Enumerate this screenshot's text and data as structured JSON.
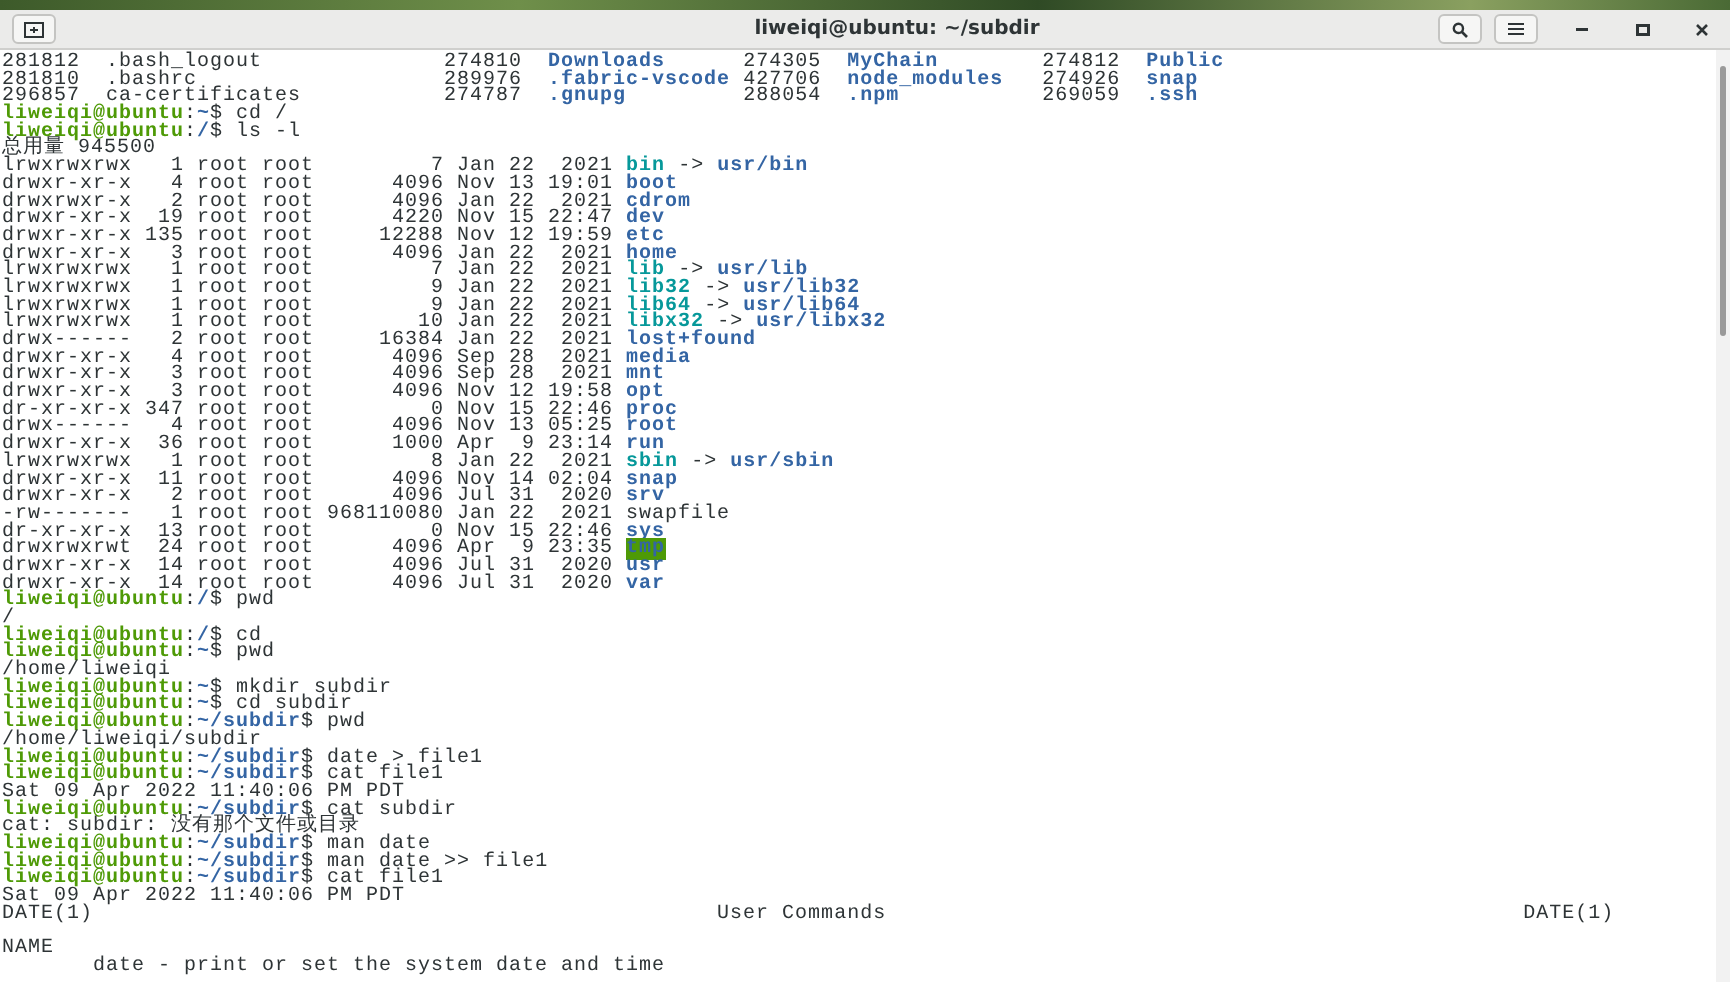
{
  "window": {
    "title": "liweiqi@ubuntu: ~/subdir"
  },
  "terminal": {
    "lines": [
      {
        "kind": "text",
        "segments": [
          {
            "text": "281812  .bash_logout              274810  ",
            "kind": "plain"
          },
          {
            "text": "Downloads",
            "kind": "dir"
          },
          {
            "text": "      274305  ",
            "kind": "plain"
          },
          {
            "text": "MyChain",
            "kind": "dir"
          },
          {
            "text": "        274812  ",
            "kind": "plain"
          },
          {
            "text": "Public",
            "kind": "dir"
          }
        ]
      },
      {
        "kind": "text",
        "segments": [
          {
            "text": "281810  .bashrc                   289976  ",
            "kind": "plain"
          },
          {
            "text": ".fabric-vscode",
            "kind": "dir"
          },
          {
            "text": " 427706  ",
            "kind": "plain"
          },
          {
            "text": "node_modules",
            "kind": "dir"
          },
          {
            "text": "   274926  ",
            "kind": "plain"
          },
          {
            "text": "snap",
            "kind": "dir"
          }
        ]
      },
      {
        "kind": "text",
        "segments": [
          {
            "text": "296857  ca-certificates           274787  ",
            "kind": "plain"
          },
          {
            "text": ".gnupg",
            "kind": "dir"
          },
          {
            "text": "         288054  ",
            "kind": "plain"
          },
          {
            "text": ".npm",
            "kind": "dir"
          },
          {
            "text": "           269059  ",
            "kind": "plain"
          },
          {
            "text": ".ssh",
            "kind": "dir"
          }
        ]
      },
      {
        "kind": "text",
        "segments": [
          {
            "text": "liweiqi@ubuntu",
            "kind": "user"
          },
          {
            "text": ":",
            "kind": "plain"
          },
          {
            "text": "~",
            "kind": "path"
          },
          {
            "text": "$ cd /",
            "kind": "plain"
          }
        ]
      },
      {
        "kind": "text",
        "segments": [
          {
            "text": "liweiqi@ubuntu",
            "kind": "user"
          },
          {
            "text": ":",
            "kind": "plain"
          },
          {
            "text": "/",
            "kind": "path"
          },
          {
            "text": "$ ls -l",
            "kind": "plain"
          }
        ]
      },
      {
        "kind": "text",
        "segments": [
          {
            "text": "总用量 945500",
            "kind": "plain"
          }
        ]
      },
      {
        "kind": "text",
        "segments": [
          {
            "text": "lrwxrwxrwx   1 root root         7 Jan 22  2021 ",
            "kind": "plain"
          },
          {
            "text": "bin",
            "kind": "link"
          },
          {
            "text": " -> ",
            "kind": "plain"
          },
          {
            "text": "usr/bin",
            "kind": "dir"
          }
        ]
      },
      {
        "kind": "text",
        "segments": [
          {
            "text": "drwxr-xr-x   4 root root      4096 Nov 13 19:01 ",
            "kind": "plain"
          },
          {
            "text": "boot",
            "kind": "dir"
          }
        ]
      },
      {
        "kind": "text",
        "segments": [
          {
            "text": "drwxrwxr-x   2 root root      4096 Jan 22  2021 ",
            "kind": "plain"
          },
          {
            "text": "cdrom",
            "kind": "dir"
          }
        ]
      },
      {
        "kind": "text",
        "segments": [
          {
            "text": "drwxr-xr-x  19 root root      4220 Nov 15 22:47 ",
            "kind": "plain"
          },
          {
            "text": "dev",
            "kind": "dir"
          }
        ]
      },
      {
        "kind": "text",
        "segments": [
          {
            "text": "drwxr-xr-x 135 root root     12288 Nov 12 19:59 ",
            "kind": "plain"
          },
          {
            "text": "etc",
            "kind": "dir"
          }
        ]
      },
      {
        "kind": "text",
        "segments": [
          {
            "text": "drwxr-xr-x   3 root root      4096 Jan 22  2021 ",
            "kind": "plain"
          },
          {
            "text": "home",
            "kind": "dir"
          }
        ]
      },
      {
        "kind": "text",
        "segments": [
          {
            "text": "lrwxrwxrwx   1 root root         7 Jan 22  2021 ",
            "kind": "plain"
          },
          {
            "text": "lib",
            "kind": "link"
          },
          {
            "text": " -> ",
            "kind": "plain"
          },
          {
            "text": "usr/lib",
            "kind": "dir"
          }
        ]
      },
      {
        "kind": "text",
        "segments": [
          {
            "text": "lrwxrwxrwx   1 root root         9 Jan 22  2021 ",
            "kind": "plain"
          },
          {
            "text": "lib32",
            "kind": "link"
          },
          {
            "text": " -> ",
            "kind": "plain"
          },
          {
            "text": "usr/lib32",
            "kind": "dir"
          }
        ]
      },
      {
        "kind": "text",
        "segments": [
          {
            "text": "lrwxrwxrwx   1 root root         9 Jan 22  2021 ",
            "kind": "plain"
          },
          {
            "text": "lib64",
            "kind": "link"
          },
          {
            "text": " -> ",
            "kind": "plain"
          },
          {
            "text": "usr/lib64",
            "kind": "dir"
          }
        ]
      },
      {
        "kind": "text",
        "segments": [
          {
            "text": "lrwxrwxrwx   1 root root        10 Jan 22  2021 ",
            "kind": "plain"
          },
          {
            "text": "libx32",
            "kind": "link"
          },
          {
            "text": " -> ",
            "kind": "plain"
          },
          {
            "text": "usr/libx32",
            "kind": "dir"
          }
        ]
      },
      {
        "kind": "text",
        "segments": [
          {
            "text": "drwx------   2 root root     16384 Jan 22  2021 ",
            "kind": "plain"
          },
          {
            "text": "lost+found",
            "kind": "dir"
          }
        ]
      },
      {
        "kind": "text",
        "segments": [
          {
            "text": "drwxr-xr-x   4 root root      4096 Sep 28  2021 ",
            "kind": "plain"
          },
          {
            "text": "media",
            "kind": "dir"
          }
        ]
      },
      {
        "kind": "text",
        "segments": [
          {
            "text": "drwxr-xr-x   3 root root      4096 Sep 28  2021 ",
            "kind": "plain"
          },
          {
            "text": "mnt",
            "kind": "dir"
          }
        ]
      },
      {
        "kind": "text",
        "segments": [
          {
            "text": "drwxr-xr-x   3 root root      4096 Nov 12 19:58 ",
            "kind": "plain"
          },
          {
            "text": "opt",
            "kind": "dir"
          }
        ]
      },
      {
        "kind": "text",
        "segments": [
          {
            "text": "dr-xr-xr-x 347 root root         0 Nov 15 22:46 ",
            "kind": "plain"
          },
          {
            "text": "proc",
            "kind": "dir"
          }
        ]
      },
      {
        "kind": "text",
        "segments": [
          {
            "text": "drwx------   4 root root      4096 Nov 13 05:25 ",
            "kind": "plain"
          },
          {
            "text": "root",
            "kind": "dir"
          }
        ]
      },
      {
        "kind": "text",
        "segments": [
          {
            "text": "drwxr-xr-x  36 root root      1000 Apr  9 23:14 ",
            "kind": "plain"
          },
          {
            "text": "run",
            "kind": "dir"
          }
        ]
      },
      {
        "kind": "text",
        "segments": [
          {
            "text": "lrwxrwxrwx   1 root root         8 Jan 22  2021 ",
            "kind": "plain"
          },
          {
            "text": "sbin",
            "kind": "link"
          },
          {
            "text": " -> ",
            "kind": "plain"
          },
          {
            "text": "usr/sbin",
            "kind": "dir"
          }
        ]
      },
      {
        "kind": "text",
        "segments": [
          {
            "text": "drwxr-xr-x  11 root root      4096 Nov 14 02:04 ",
            "kind": "plain"
          },
          {
            "text": "snap",
            "kind": "dir"
          }
        ]
      },
      {
        "kind": "text",
        "segments": [
          {
            "text": "drwxr-xr-x   2 root root      4096 Jul 31  2020 ",
            "kind": "plain"
          },
          {
            "text": "srv",
            "kind": "dir"
          }
        ]
      },
      {
        "kind": "text",
        "segments": [
          {
            "text": "-rw-------   1 root root 968110080 Jan 22  2021 swapfile",
            "kind": "plain"
          }
        ]
      },
      {
        "kind": "text",
        "segments": [
          {
            "text": "dr-xr-xr-x  13 root root         0 Nov 15 22:46 ",
            "kind": "plain"
          },
          {
            "text": "sys",
            "kind": "dir"
          }
        ]
      },
      {
        "kind": "text",
        "segments": [
          {
            "text": "drwxrwxrwt  24 root root      4096 Apr  9 23:35 ",
            "kind": "plain"
          },
          {
            "text": "tmp",
            "kind": "sticky"
          }
        ]
      },
      {
        "kind": "text",
        "segments": [
          {
            "text": "drwxr-xr-x  14 root root      4096 Jul 31  2020 ",
            "kind": "plain"
          },
          {
            "text": "usr",
            "kind": "dir"
          }
        ]
      },
      {
        "kind": "text",
        "segments": [
          {
            "text": "drwxr-xr-x  14 root root      4096 Jul 31  2020 ",
            "kind": "plain"
          },
          {
            "text": "var",
            "kind": "dir"
          }
        ]
      },
      {
        "kind": "text",
        "segments": [
          {
            "text": "liweiqi@ubuntu",
            "kind": "user"
          },
          {
            "text": ":",
            "kind": "plain"
          },
          {
            "text": "/",
            "kind": "path"
          },
          {
            "text": "$ pwd",
            "kind": "plain"
          }
        ]
      },
      {
        "kind": "text",
        "segments": [
          {
            "text": "/",
            "kind": "plain"
          }
        ]
      },
      {
        "kind": "text",
        "segments": [
          {
            "text": "liweiqi@ubuntu",
            "kind": "user"
          },
          {
            "text": ":",
            "kind": "plain"
          },
          {
            "text": "/",
            "kind": "path"
          },
          {
            "text": "$ cd",
            "kind": "plain"
          }
        ]
      },
      {
        "kind": "text",
        "segments": [
          {
            "text": "liweiqi@ubuntu",
            "kind": "user"
          },
          {
            "text": ":",
            "kind": "plain"
          },
          {
            "text": "~",
            "kind": "path"
          },
          {
            "text": "$ pwd",
            "kind": "plain"
          }
        ]
      },
      {
        "kind": "text",
        "segments": [
          {
            "text": "/home/liweiqi",
            "kind": "plain"
          }
        ]
      },
      {
        "kind": "text",
        "segments": [
          {
            "text": "liweiqi@ubuntu",
            "kind": "user"
          },
          {
            "text": ":",
            "kind": "plain"
          },
          {
            "text": "~",
            "kind": "path"
          },
          {
            "text": "$ mkdir subdir",
            "kind": "plain"
          }
        ]
      },
      {
        "kind": "text",
        "segments": [
          {
            "text": "liweiqi@ubuntu",
            "kind": "user"
          },
          {
            "text": ":",
            "kind": "plain"
          },
          {
            "text": "~",
            "kind": "path"
          },
          {
            "text": "$ cd subdir",
            "kind": "plain"
          }
        ]
      },
      {
        "kind": "text",
        "segments": [
          {
            "text": "liweiqi@ubuntu",
            "kind": "user"
          },
          {
            "text": ":",
            "kind": "plain"
          },
          {
            "text": "~/subdir",
            "kind": "path"
          },
          {
            "text": "$ pwd",
            "kind": "plain"
          }
        ]
      },
      {
        "kind": "text",
        "segments": [
          {
            "text": "/home/liweiqi/subdir",
            "kind": "plain"
          }
        ]
      },
      {
        "kind": "text",
        "segments": [
          {
            "text": "liweiqi@ubuntu",
            "kind": "user"
          },
          {
            "text": ":",
            "kind": "plain"
          },
          {
            "text": "~/subdir",
            "kind": "path"
          },
          {
            "text": "$ date > file1",
            "kind": "plain"
          }
        ]
      },
      {
        "kind": "text",
        "segments": [
          {
            "text": "liweiqi@ubuntu",
            "kind": "user"
          },
          {
            "text": ":",
            "kind": "plain"
          },
          {
            "text": "~/subdir",
            "kind": "path"
          },
          {
            "text": "$ cat file1",
            "kind": "plain"
          }
        ]
      },
      {
        "kind": "text",
        "segments": [
          {
            "text": "Sat 09 Apr 2022 11:40:06 PM PDT",
            "kind": "plain"
          }
        ]
      },
      {
        "kind": "text",
        "segments": [
          {
            "text": "liweiqi@ubuntu",
            "kind": "user"
          },
          {
            "text": ":",
            "kind": "plain"
          },
          {
            "text": "~/subdir",
            "kind": "path"
          },
          {
            "text": "$ cat subdir",
            "kind": "plain"
          }
        ]
      },
      {
        "kind": "text",
        "segments": [
          {
            "text": "cat: subdir: 没有那个文件或目录",
            "kind": "plain"
          }
        ]
      },
      {
        "kind": "text",
        "segments": [
          {
            "text": "liweiqi@ubuntu",
            "kind": "user"
          },
          {
            "text": ":",
            "kind": "plain"
          },
          {
            "text": "~/subdir",
            "kind": "path"
          },
          {
            "text": "$ man date",
            "kind": "plain"
          }
        ]
      },
      {
        "kind": "text",
        "segments": [
          {
            "text": "liweiqi@ubuntu",
            "kind": "user"
          },
          {
            "text": ":",
            "kind": "plain"
          },
          {
            "text": "~/subdir",
            "kind": "path"
          },
          {
            "text": "$ man date >> file1",
            "kind": "plain"
          }
        ]
      },
      {
        "kind": "text",
        "segments": [
          {
            "text": "liweiqi@ubuntu",
            "kind": "user"
          },
          {
            "text": ":",
            "kind": "plain"
          },
          {
            "text": "~/subdir",
            "kind": "path"
          },
          {
            "text": "$ cat file1",
            "kind": "plain"
          }
        ]
      },
      {
        "kind": "text",
        "segments": [
          {
            "text": "Sat 09 Apr 2022 11:40:06 PM PDT",
            "kind": "plain"
          }
        ]
      },
      {
        "kind": "text",
        "segments": [
          {
            "text": "DATE(1)                                                User Commands                                                 DATE(1)",
            "kind": "plain"
          }
        ]
      },
      {
        "kind": "blank"
      },
      {
        "kind": "text",
        "segments": [
          {
            "text": "NAME",
            "kind": "plain"
          }
        ]
      },
      {
        "kind": "text",
        "segments": [
          {
            "text": "       date - print or set the system date and time",
            "kind": "plain"
          }
        ]
      }
    ]
  }
}
